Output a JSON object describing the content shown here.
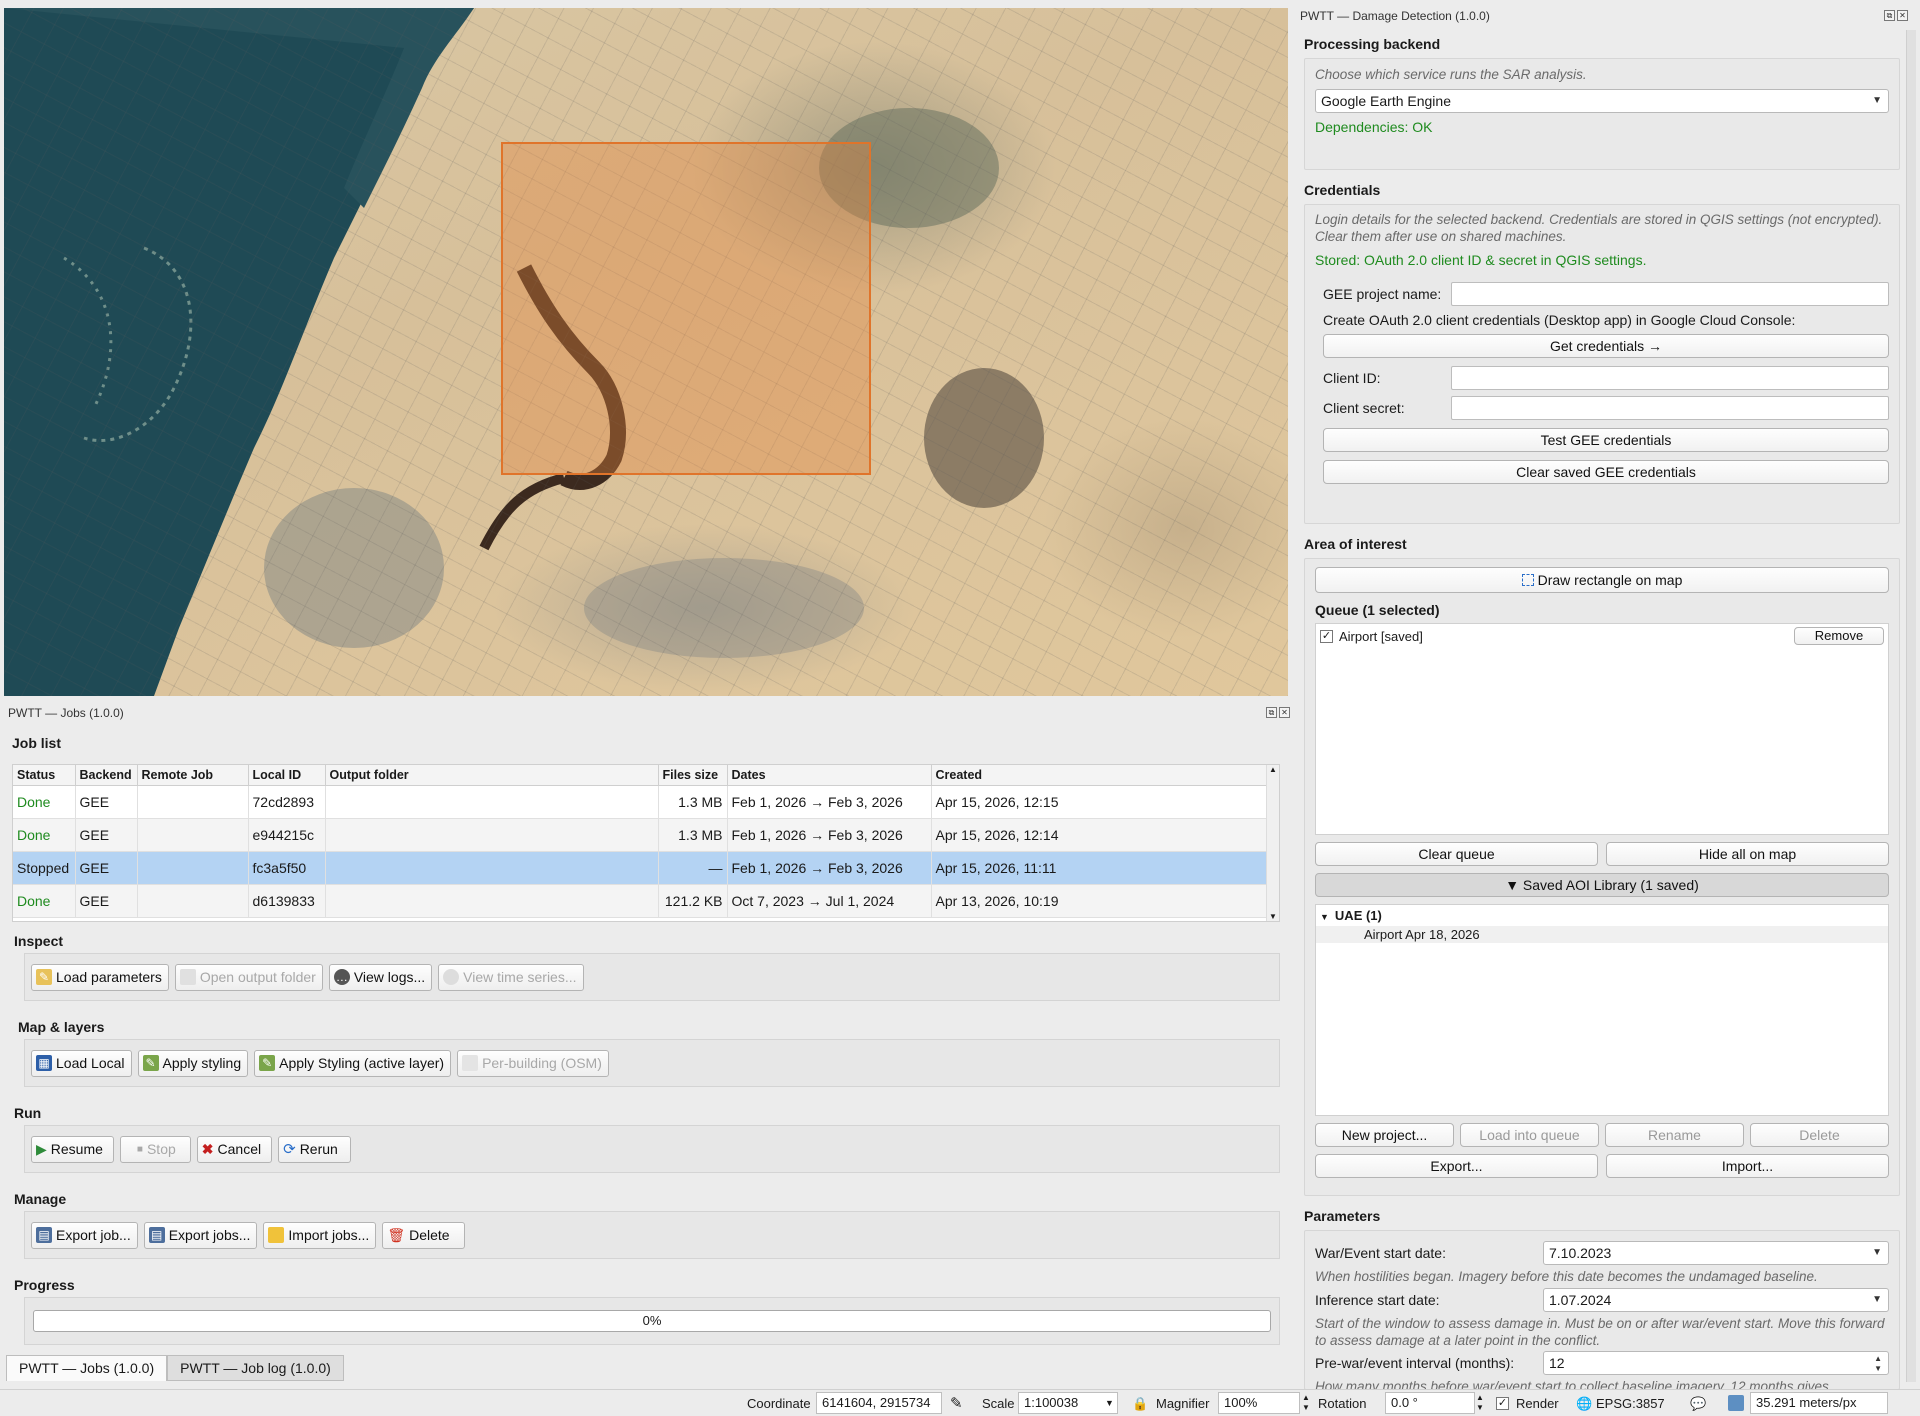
{
  "dock_right": {
    "title": "PWTT — Damage Detection (1.0.0)",
    "backend": {
      "heading": "Processing backend",
      "hint": "Choose which service runs the SAR analysis.",
      "selected": "Google Earth Engine",
      "status": "Dependencies: OK"
    },
    "credentials": {
      "heading": "Credentials",
      "hint": "Login details for the selected backend. Credentials are stored in QGIS settings (not encrypted). Clear them after use on shared machines.",
      "stored": "Stored: OAuth 2.0 client ID & secret in QGIS settings.",
      "project_label": "GEE project name:",
      "oauth_note": "Create OAuth 2.0 client credentials (Desktop app) in Google Cloud Console:",
      "get_btn": "Get credentials →",
      "client_id_label": "Client ID:",
      "client_secret_label": "Client secret:",
      "test_btn": "Test GEE credentials",
      "clear_btn": "Clear saved GEE credentials"
    },
    "aoi": {
      "heading": "Area of interest",
      "draw_btn": "Draw rectangle on map",
      "queue_label": "Queue  (1 selected)",
      "queue_items": [
        {
          "name": "Airport  [saved]",
          "remove": "Remove"
        }
      ],
      "clear_queue": "Clear queue",
      "hide_all": "Hide all on map",
      "library_label": "▼ Saved AOI Library  (1 saved)",
      "library_group": "UAE  (1)",
      "library_item": "Airport  Apr 18, 2026",
      "new_project": "New project...",
      "load_into_queue": "Load into queue",
      "rename": "Rename",
      "delete": "Delete",
      "export": "Export...",
      "import": "Import..."
    },
    "params": {
      "heading": "Parameters",
      "war_label": "War/Event start date:",
      "war_value": "7.10.2023",
      "war_hint": "When hostilities began. Imagery before this date becomes the undamaged baseline.",
      "inf_label": "Inference start date:",
      "inf_value": "1.07.2024",
      "inf_hint": "Start of the window to assess damage in. Must be on or after war/event start. Move this forward to assess damage at a later point in the conflict.",
      "pre_label": "Pre-war/event interval (months):",
      "pre_value": "12",
      "pre_hint": "How many months before war/event start to collect baseline imagery. 12 months gives"
    }
  },
  "jobs": {
    "title": "PWTT — Jobs (1.0.0)",
    "list_heading": "Job list",
    "columns": [
      "Status",
      "Backend",
      "Remote Job",
      "Local ID",
      "Output folder",
      "Files size",
      "Dates",
      "Created"
    ],
    "rows": [
      {
        "status": "Done",
        "backend": "GEE",
        "remote": "",
        "local_id": "72cd2893",
        "folder": "",
        "size": "1.3 MB",
        "dates": "Feb 1, 2026 → Feb 3, 2026",
        "created": "Apr 15, 2026, 12:15"
      },
      {
        "status": "Done",
        "backend": "GEE",
        "remote": "",
        "local_id": "e944215c",
        "folder": "",
        "size": "1.3 MB",
        "dates": "Feb 1, 2026 → Feb 3, 2026",
        "created": "Apr 15, 2026, 12:14"
      },
      {
        "status": "Stopped",
        "backend": "GEE",
        "remote": "",
        "local_id": "fc3a5f50",
        "folder": "",
        "size": "—",
        "dates": "Feb 1, 2026 → Feb 3, 2026",
        "created": "Apr 15, 2026, 11:11"
      },
      {
        "status": "Done",
        "backend": "GEE",
        "remote": "",
        "local_id": "d6139833",
        "folder": "",
        "size": "121.2 KB",
        "dates": "Oct 7, 2023 → Jul 1, 2024",
        "created": "Apr 13, 2026, 10:19"
      }
    ],
    "inspect": {
      "heading": "Inspect",
      "load_params": "Load parameters",
      "open_folder": "Open output folder",
      "view_logs": "View logs...",
      "view_ts": "View time series..."
    },
    "map_layers": {
      "heading": "Map & layers",
      "load_local": "Load Local",
      "apply_styling": "Apply styling",
      "apply_active": "Apply Styling (active layer)",
      "per_building": "Per-building (OSM)"
    },
    "run": {
      "heading": "Run",
      "resume": "Resume",
      "stop": "Stop",
      "cancel": "Cancel",
      "rerun": "Rerun"
    },
    "manage": {
      "heading": "Manage",
      "export_job": "Export job...",
      "export_jobs": "Export jobs...",
      "import_jobs": "Import jobs...",
      "delete": "Delete"
    },
    "progress": {
      "heading": "Progress",
      "text": "0%",
      "value": 0
    },
    "tabs": [
      "PWTT — Jobs (1.0.0)",
      "PWTT — Job log (1.0.0)"
    ]
  },
  "statusbar": {
    "coordinate_label": "Coordinate",
    "coordinate_value": "6141604, 2915734",
    "scale_label": "Scale",
    "scale_value": "1:100038",
    "magnifier_label": "Magnifier",
    "magnifier_value": "100%",
    "rotation_label": "Rotation",
    "rotation_value": "0.0 °",
    "render_label": "Render",
    "crs": "EPSG:3857",
    "resolution": "35.291 meters/px"
  },
  "colors": {
    "aoi": "#e0742a",
    "selected_row": "#b4d3f3",
    "ok_text": "#1f8b1f"
  }
}
